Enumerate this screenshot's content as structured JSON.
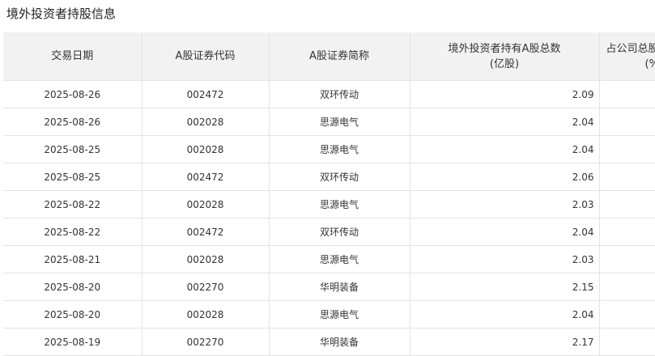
{
  "page": {
    "title": "境外投资者持股信息"
  },
  "table": {
    "headers": {
      "date": "交易日期",
      "code": "A股证券代码",
      "name": "A股证券简称",
      "holding_line1": "境外投资者持有A股总数",
      "holding_line2": "(亿股)",
      "ratio_line1": "占公司总股本",
      "ratio_line2": "(%)"
    },
    "rows": [
      {
        "date": "2025-08-26",
        "code": "002472",
        "name": "双环传动",
        "holding": "2.09",
        "ratio": ""
      },
      {
        "date": "2025-08-26",
        "code": "002028",
        "name": "思源电气",
        "holding": "2.04",
        "ratio": ""
      },
      {
        "date": "2025-08-25",
        "code": "002028",
        "name": "思源电气",
        "holding": "2.04",
        "ratio": ""
      },
      {
        "date": "2025-08-25",
        "code": "002472",
        "name": "双环传动",
        "holding": "2.06",
        "ratio": ""
      },
      {
        "date": "2025-08-22",
        "code": "002028",
        "name": "思源电气",
        "holding": "2.03",
        "ratio": ""
      },
      {
        "date": "2025-08-22",
        "code": "002472",
        "name": "双环传动",
        "holding": "2.04",
        "ratio": ""
      },
      {
        "date": "2025-08-21",
        "code": "002028",
        "name": "思源电气",
        "holding": "2.03",
        "ratio": ""
      },
      {
        "date": "2025-08-20",
        "code": "002270",
        "name": "华明装备",
        "holding": "2.15",
        "ratio": ""
      },
      {
        "date": "2025-08-20",
        "code": "002028",
        "name": "思源电气",
        "holding": "2.04",
        "ratio": ""
      },
      {
        "date": "2025-08-19",
        "code": "002270",
        "name": "华明装备",
        "holding": "2.17",
        "ratio": ""
      }
    ]
  }
}
